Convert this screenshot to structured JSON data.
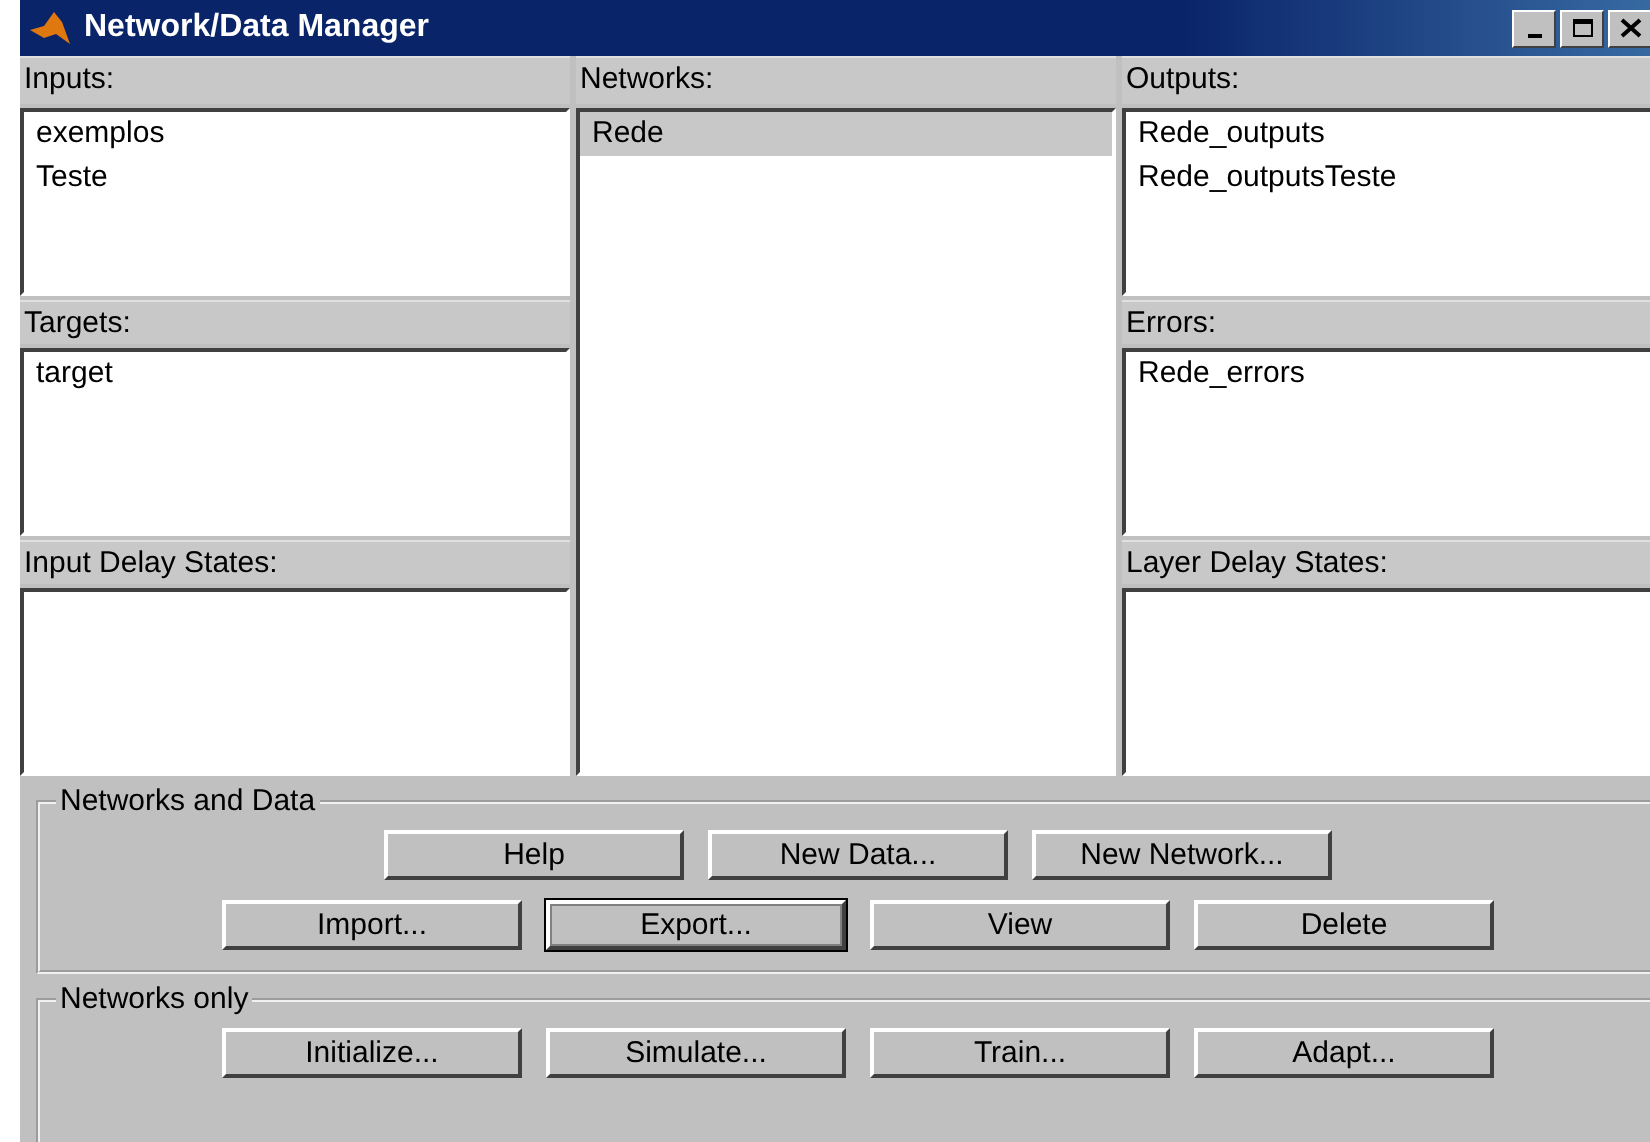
{
  "window": {
    "title": "Network/Data Manager"
  },
  "left_panels": [
    {
      "label": "Inputs:",
      "items": [
        {
          "text": "exemplos",
          "selected": false
        },
        {
          "text": "Teste",
          "selected": false
        }
      ]
    },
    {
      "label": "Targets:",
      "items": [
        {
          "text": "target",
          "selected": false
        }
      ]
    },
    {
      "label": "Input Delay States:"
    }
  ],
  "networks": {
    "label": "Networks:",
    "items": [
      {
        "text": "Rede",
        "selected": true
      }
    ]
  },
  "right_panels": [
    {
      "label": "Outputs:",
      "items": [
        {
          "text": "Rede_outputs",
          "selected": false
        },
        {
          "text": "Rede_outputsTeste",
          "selected": false
        }
      ]
    },
    {
      "label": "Errors:",
      "items": [
        {
          "text": "Rede_errors",
          "selected": false
        }
      ]
    },
    {
      "label": "Layer Delay States:"
    }
  ],
  "groups": [
    {
      "title": "Networks and Data",
      "rows": [
        [
          {
            "label": "Help",
            "focused": false
          },
          {
            "label": "New Data...",
            "focused": false
          },
          {
            "label": "New Network...",
            "focused": false
          }
        ],
        [
          {
            "label": "Import...",
            "focused": false
          },
          {
            "label": "Export...",
            "focused": true
          },
          {
            "label": "View",
            "focused": false
          },
          {
            "label": "Delete",
            "focused": false
          }
        ]
      ]
    },
    {
      "title": "Networks only",
      "rows": [
        [
          {
            "label": "Initialize...",
            "focused": false
          },
          {
            "label": "Simulate...",
            "focused": false
          },
          {
            "label": "Train...",
            "focused": false
          },
          {
            "label": "Adapt...",
            "focused": false
          }
        ]
      ]
    }
  ]
}
